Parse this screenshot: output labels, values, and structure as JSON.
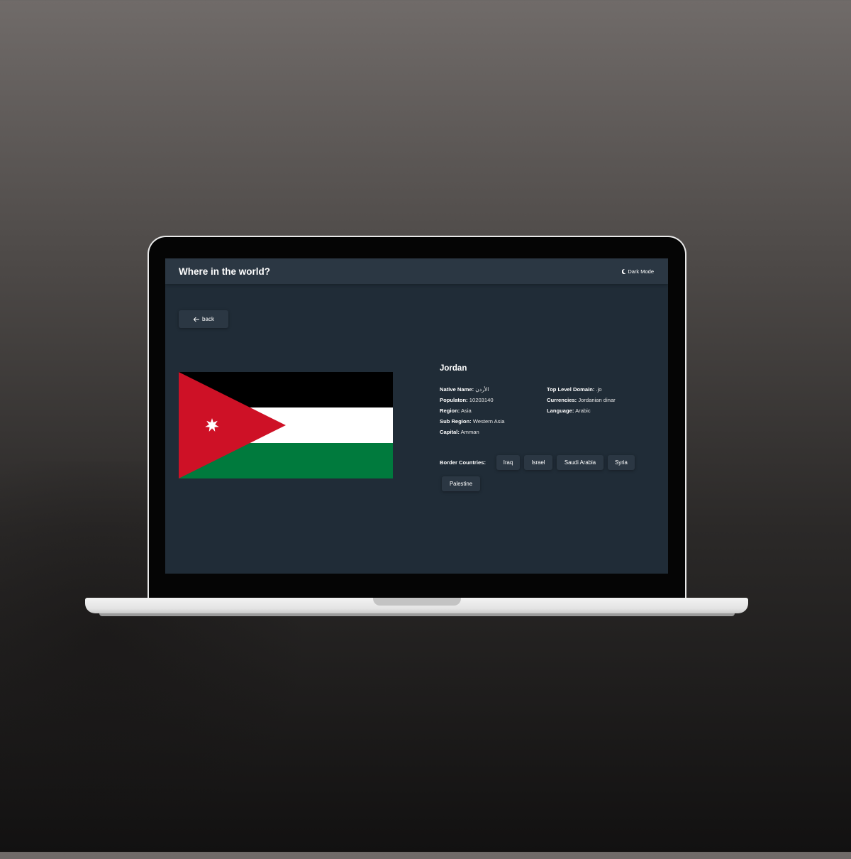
{
  "app": {
    "title": "Where in the world?",
    "theme_toggle_label": "Dark Mode",
    "theme_icon": "moon-icon"
  },
  "back_button": {
    "label": "back",
    "icon": "arrow-left-icon"
  },
  "country": {
    "name": "Jordan",
    "flag": {
      "stripes": [
        "#000000",
        "#ffffff",
        "#007a3d"
      ],
      "triangle": "#ce1126",
      "star": "#ffffff"
    },
    "left_details": [
      {
        "key": "Native Name:",
        "value": "الأردن"
      },
      {
        "key": "Populaton:",
        "value": "10203140"
      },
      {
        "key": "Region:",
        "value": "Asia"
      },
      {
        "key": "Sub Region:",
        "value": "Western Asia"
      },
      {
        "key": "Capital:",
        "value": "Amman"
      }
    ],
    "right_details": [
      {
        "key": "Top Level Domain:",
        "value": ".jo"
      },
      {
        "key": "Currencies:",
        "value": "Jordanian dinar"
      },
      {
        "key": "Language:",
        "value": "Arabic"
      }
    ],
    "border_label": "Border Countries:",
    "borders": [
      "Iraq",
      "Israel",
      "Saudi Arabia",
      "Syria",
      "Palestine"
    ]
  },
  "colors": {
    "background": "#202c37",
    "element": "#2b3743",
    "text": "#ffffff"
  }
}
